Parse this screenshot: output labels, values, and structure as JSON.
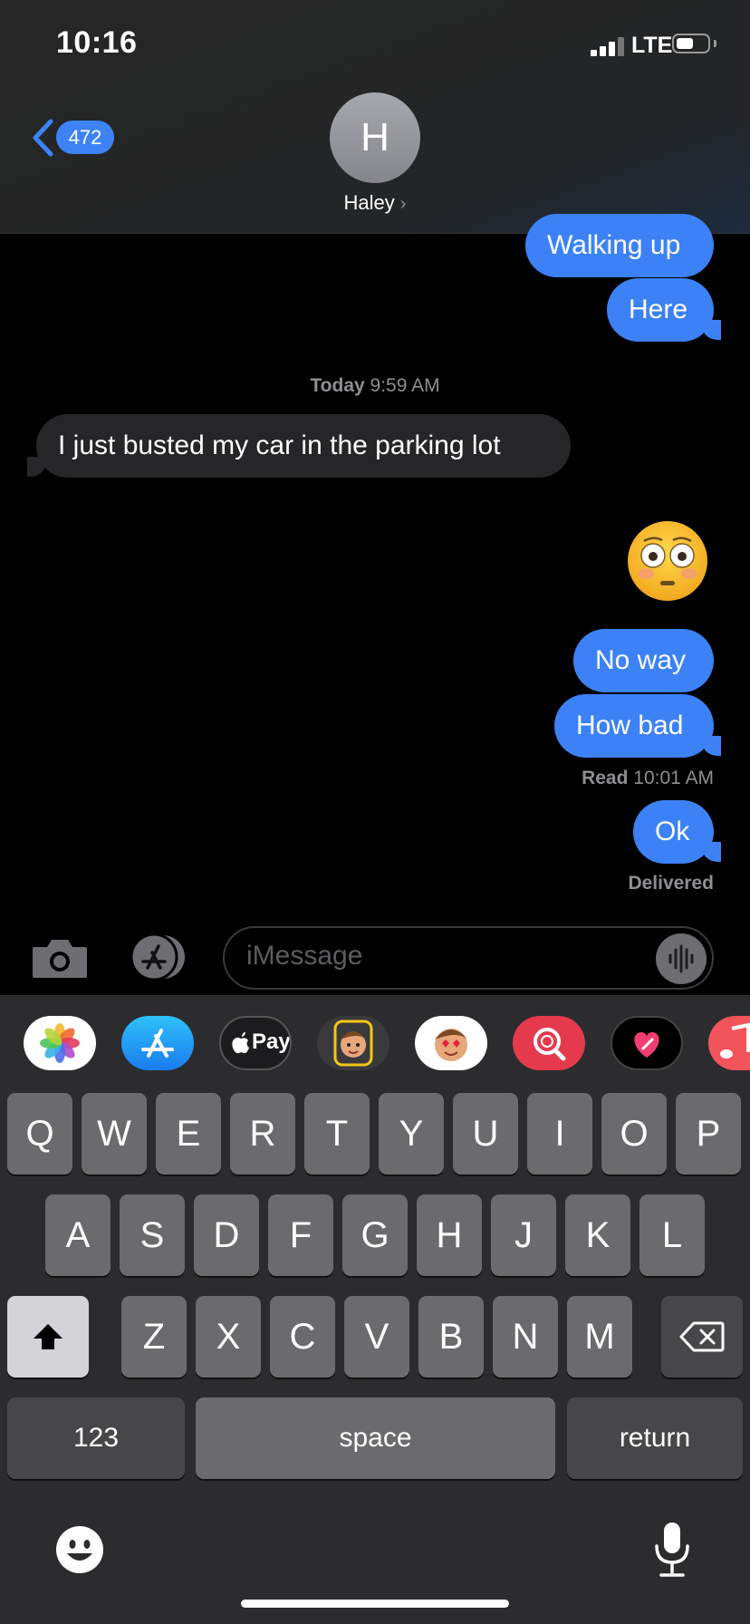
{
  "status_bar": {
    "time": "10:16",
    "network": "LTE",
    "signal_icon": "signal-bars-icon",
    "battery_icon": "battery-icon"
  },
  "header": {
    "back_count": "472",
    "avatar_initial": "H",
    "contact_name": "Haley",
    "name_chevron": "›"
  },
  "messages": [
    {
      "side": "sent",
      "text": "Walking up"
    },
    {
      "side": "sent",
      "text": "Here"
    },
    {
      "type": "timestamp",
      "day": "Today",
      "time": "9:59 AM"
    },
    {
      "side": "received",
      "text": "I just busted my car in the parking lot"
    },
    {
      "side": "sent",
      "type": "emoji",
      "icon": "flushed-face-emoji"
    },
    {
      "side": "sent",
      "text": "No way"
    },
    {
      "side": "sent",
      "text": "How bad"
    },
    {
      "type": "receipt",
      "label": "Read",
      "time": "10:01 AM"
    },
    {
      "side": "sent",
      "text": "Ok"
    },
    {
      "type": "receipt",
      "label": "Delivered"
    }
  ],
  "input_bar": {
    "placeholder": "iMessage",
    "camera_icon": "camera-icon",
    "apps_icon": "app-store-icon",
    "audio_icon": "audio-waveform-icon"
  },
  "app_drawer": [
    {
      "icon": "photos-icon"
    },
    {
      "icon": "app-store-icon"
    },
    {
      "icon": "apple-pay-icon",
      "label": "Pay"
    },
    {
      "icon": "memoji-icon"
    },
    {
      "icon": "memoji-stickers-icon"
    },
    {
      "icon": "images-search-icon"
    },
    {
      "icon": "digital-touch-icon"
    },
    {
      "icon": "music-icon"
    }
  ],
  "keyboard": {
    "row1": [
      "Q",
      "W",
      "E",
      "R",
      "T",
      "Y",
      "U",
      "I",
      "O",
      "P"
    ],
    "row2": [
      "A",
      "S",
      "D",
      "F",
      "G",
      "H",
      "J",
      "K",
      "L"
    ],
    "row3": [
      "Z",
      "X",
      "C",
      "V",
      "B",
      "N",
      "M"
    ],
    "numbers_key": "123",
    "space_key": "space",
    "return_key": "return",
    "shift_icon": "shift-icon",
    "delete_icon": "delete-icon",
    "emoji_icon": "emoji-icon",
    "mic_icon": "microphone-icon"
  },
  "colors": {
    "sent_bubble": "#3c82f6",
    "received_bubble": "#262628",
    "accent": "#3d82f6"
  }
}
